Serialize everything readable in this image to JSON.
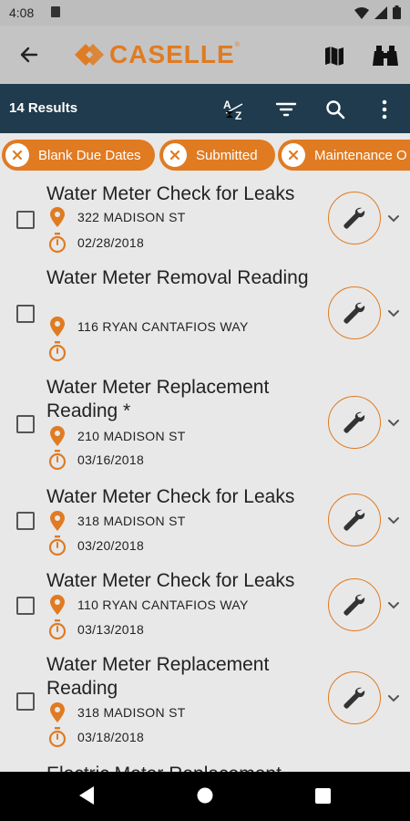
{
  "status": {
    "time": "4:08"
  },
  "app": {
    "brand": "CASELLE",
    "tm": "®"
  },
  "toolbar": {
    "results": "14 Results"
  },
  "filters": [
    {
      "label": "Blank Due Dates"
    },
    {
      "label": "Submitted"
    },
    {
      "label": "Maintenance O"
    }
  ],
  "items": [
    {
      "title": "Water Meter Check for Leaks",
      "address": "322 MADISON ST",
      "date": "02/28/2018"
    },
    {
      "title": "Water Meter Removal Reading",
      "address": "116 RYAN CANTAFIOS WAY",
      "date": ""
    },
    {
      "title": "Water Meter Replacement Reading *",
      "address": "210 MADISON ST",
      "date": "03/16/2018"
    },
    {
      "title": "Water Meter Check for Leaks",
      "address": "318 MADISON ST",
      "date": "03/20/2018"
    },
    {
      "title": "Water Meter Check for Leaks",
      "address": "110 RYAN CANTAFIOS WAY",
      "date": "03/13/2018"
    },
    {
      "title": "Water Meter Replacement Reading",
      "address": "318 MADISON ST",
      "date": "03/18/2018"
    },
    {
      "title": "Electric Meter Replacement",
      "address": "",
      "date": ""
    }
  ],
  "colors": {
    "accent": "#e07b22",
    "toolbar": "#1f3b4d",
    "appbar": "#c4c4c4",
    "statusbar": "#bdbdbd",
    "background": "#e8e8e8"
  },
  "icons": [
    "back-arrow-icon",
    "map-icon",
    "binoculars-icon",
    "sort-az-icon",
    "filter-icon",
    "search-icon",
    "more-vert-icon",
    "close-icon",
    "location-pin-icon",
    "timer-icon",
    "wrench-icon",
    "chevron-down-icon"
  ]
}
